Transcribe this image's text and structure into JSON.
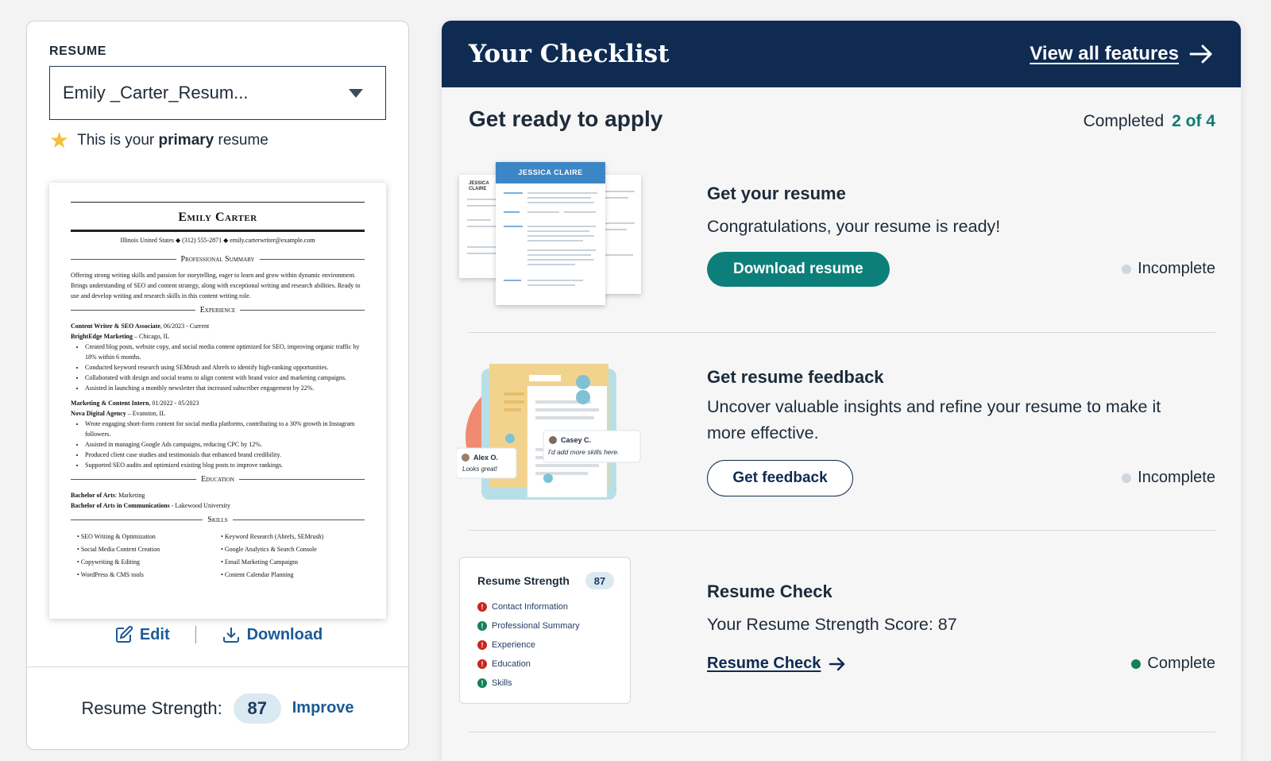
{
  "left": {
    "resume_label": "RESUME",
    "selected_resume": "Emily _Carter_Resum...",
    "primary_prefix": "This is your ",
    "primary_bold": "primary",
    "primary_suffix": " resume",
    "edit_label": "Edit",
    "download_label": "Download",
    "strength_label": "Resume Strength:",
    "strength_score": "87",
    "improve_label": "Improve"
  },
  "resume_preview": {
    "name": "Emily Carter",
    "contact": "Illinois United States ◆ (312) 555-2871 ◆ emily.carterwriter@example.com",
    "summary_heading": "Professional Summary",
    "summary": "Offering strong writing skills and passion for storytelling, eager to learn and grow within dynamic environment. Brings understanding of SEO and content strategy, along with exceptional writing and research abilities. Ready to use and develop writing and research skills in this content writing role.",
    "experience_heading": "Experience",
    "job1_title": "Content Writer & SEO Associate",
    "job1_dates": ", 06/2023 - Current",
    "job1_company": "BrightEdge Marketing",
    "job1_location": " – Chicago, IL",
    "job1_bullets": [
      "Created blog posts, website copy, and social media content optimized for SEO, improving organic traffic by 18% within 6 months.",
      "Conducted keyword research using SEMrush and Ahrefs to identify high-ranking opportunities.",
      "Collaborated with design and social teams to align content with brand voice and marketing campaigns.",
      "Assisted in launching a monthly newsletter that increased subscriber engagement by 22%."
    ],
    "job2_title": "Marketing & Content Intern",
    "job2_dates": ", 01/2022 - 05/2023",
    "job2_company": "Nova Digital Agency",
    "job2_location": " – Evanston, IL",
    "job2_bullets": [
      "Wrote engaging short-form content for social media platforms, contributing to a 30% growth in Instagram followers.",
      "Assisted in managing Google Ads campaigns, reducing CPC by 12%.",
      "Produced client case studies and testimonials that enhanced brand credibility.",
      "Supported SEO audits and optimized existing blog posts to improve rankings."
    ],
    "education_heading": "Education",
    "edu1_degree": "Bachelor of Arts",
    "edu1_field": ": Marketing",
    "edu2_degree": "Bachelor of Arts in Communications",
    "edu2_school": " - Lakewood University",
    "skills_heading": "Skills",
    "skills": [
      "SEO Writing & Optimization",
      "Keyword Research (Ahrefs, SEMrush)",
      "Social Media Content Creation",
      "Google Analytics & Search Console",
      "Copywriting & Editing",
      "Email Marketing Campaigns",
      "WordPress & CMS tools",
      "Content Calendar Planning"
    ]
  },
  "checklist": {
    "title": "Your Checklist",
    "view_all": "View all features",
    "subhead": "Get ready to apply",
    "completed_label": "Completed",
    "completed_count": "2 of 4",
    "tasks": [
      {
        "title": "Get your resume",
        "desc": "Congratulations, your resume is ready!",
        "action": "Download resume",
        "status": "Incomplete"
      },
      {
        "title": "Get resume feedback",
        "desc": "Uncover valuable insights and refine your resume to make it more effective.",
        "action": "Get feedback",
        "status": "Incomplete"
      },
      {
        "title": "Resume Check",
        "desc": "Your Resume Strength Score: 87",
        "action": "Resume Check",
        "status": "Complete"
      }
    ]
  },
  "thumbnails": {
    "template_front_name": "JESSICA CLAIRE",
    "template_back_name_1": "JESSICA",
    "template_back_name_2": "CLAIRE",
    "feedback_name_1": "Alex O.",
    "feedback_note_1": "Looks great!",
    "feedback_name_2": "Casey C.",
    "feedback_note_2": "I'd add more skills here.",
    "strength_title": "Resume Strength",
    "strength_score": "87",
    "strength_items": [
      {
        "label": "Contact Information",
        "state": "bad"
      },
      {
        "label": "Professional Summary",
        "state": "good"
      },
      {
        "label": "Experience",
        "state": "bad"
      },
      {
        "label": "Education",
        "state": "bad"
      },
      {
        "label": "Skills",
        "state": "good"
      }
    ]
  },
  "colors": {
    "header_navy": "#0f2b52",
    "teal_button": "#0d7f7a",
    "link_blue": "#1b5a96",
    "complete_green": "#12805a",
    "incomplete_gray": "#cfd6dd"
  }
}
